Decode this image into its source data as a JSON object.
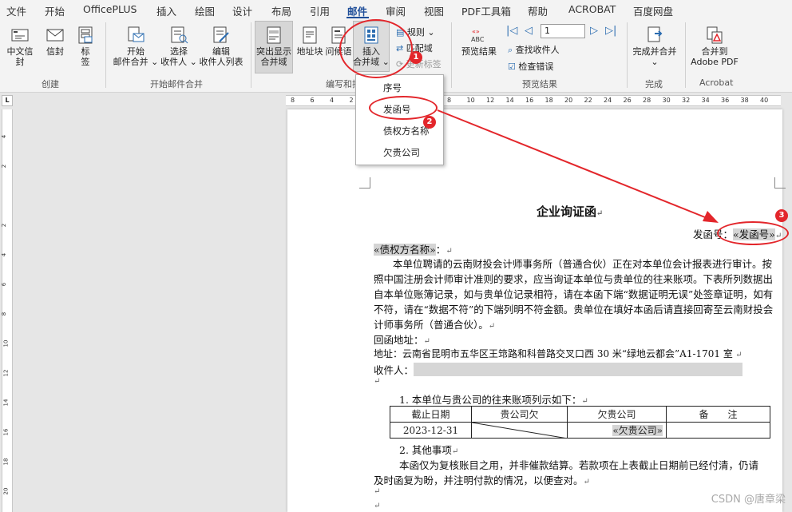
{
  "menu": {
    "tabs": [
      "文件",
      "开始",
      "OfficePLUS",
      "插入",
      "绘图",
      "设计",
      "布局",
      "引用",
      "邮件",
      "审阅",
      "视图",
      "PDF工具箱",
      "帮助",
      "ACROBAT",
      "百度网盘"
    ]
  },
  "ribbon": {
    "create": {
      "label": "创建",
      "chinese_envelope": "中文信封",
      "envelope": "信封",
      "labels_1": "标",
      "labels_2": "签"
    },
    "start_merge": {
      "label": "开始邮件合并",
      "start_1": "开始",
      "start_2": "邮件合并 ⌄",
      "select_1": "选择",
      "select_2": "收件人 ⌄",
      "edit_1": "编辑",
      "edit_2": "收件人列表"
    },
    "write_insert": {
      "label": "编写和插入域",
      "highlight_1": "突出显示",
      "highlight_2": "合并域",
      "address": "地址块",
      "greeting": "问候语",
      "insert_1": "插入",
      "insert_2": "合并域 ⌄",
      "rules": "规则 ⌄",
      "match": "匹配域",
      "update": "更新标签"
    },
    "preview": {
      "label": "预览结果",
      "preview_results": "预览结果",
      "record_value": "1",
      "find_recipient": "查找收件人",
      "check_errors": "检查错误"
    },
    "finish": {
      "label": "完成",
      "finish_merge_1": "完成并合并",
      "finish_merge_2": "⌄"
    },
    "acrobat": {
      "label": "Acrobat",
      "merge_pdf_1": "合并到",
      "merge_pdf_2": "Adobe PDF"
    }
  },
  "ruler": {
    "marks": [
      "8",
      "6",
      "4",
      "2",
      "",
      "2",
      "4",
      "6",
      "8",
      "10",
      "12",
      "14",
      "16",
      "18",
      "20",
      "22",
      "24",
      "26",
      "28",
      "30",
      "32",
      "34",
      "36",
      "38",
      "40"
    ],
    "vmarks": [
      "4",
      "2",
      "",
      "2",
      "4",
      "6",
      "8",
      "10",
      "12",
      "14",
      "16",
      "18",
      "20"
    ]
  },
  "dropdown": {
    "items": [
      "序号",
      "发函号",
      "债权方名称",
      "欠贵公司"
    ]
  },
  "document": {
    "title": "企业询证函",
    "ref_label": "发函号：",
    "ref_field": "«发函号»",
    "creditor_field": "«债权方名称»",
    "creditor_suffix": "：",
    "para1": [
      "本单位聘请的云南财投会计师事务所（普通合伙）正在对本单位会计报表进行审计。按",
      "照中国注册会计师审计准则的要求，应当询证本单位与贵单位的往来账项。下表所列数据出",
      "自本单位账簿记录，如与贵单位记录相符，请在本函下端“数据证明无误”处签章证明，如有",
      "不符，请在“数据不符”的下端列明不符金额。贵单位在填好本函后请直接回寄至云南财投会",
      "计师事务所（普通合伙）。"
    ],
    "reply_address_label": "回函地址：",
    "address_line": "地址：云南省昆明市五华区王筇路和科普路交叉口西 30 米“绿地云都会”A1-1701 室",
    "recipient_label": "收件人：",
    "item1": "1.  本单位与贵公司的往来账项列示如下：",
    "table": {
      "headers": [
        "截止日期",
        "贵公司欠",
        "欠贵公司",
        "备　　注"
      ],
      "row": [
        "2023-12-31",
        "",
        "«欠贵公司»",
        ""
      ]
    },
    "item2": "2.  其他事项",
    "para2": [
      "本函仅为复核账目之用，并非催款结算。若款项在上表截止日期前已经付清，仍请",
      "及时函复为盼，并注明付款的情况，以便查对。"
    ]
  },
  "annotations": {
    "badge1": "1",
    "badge2": "2",
    "badge3": "3",
    "accent": "#e3262b"
  },
  "watermark": "CSDN @唐章梁"
}
